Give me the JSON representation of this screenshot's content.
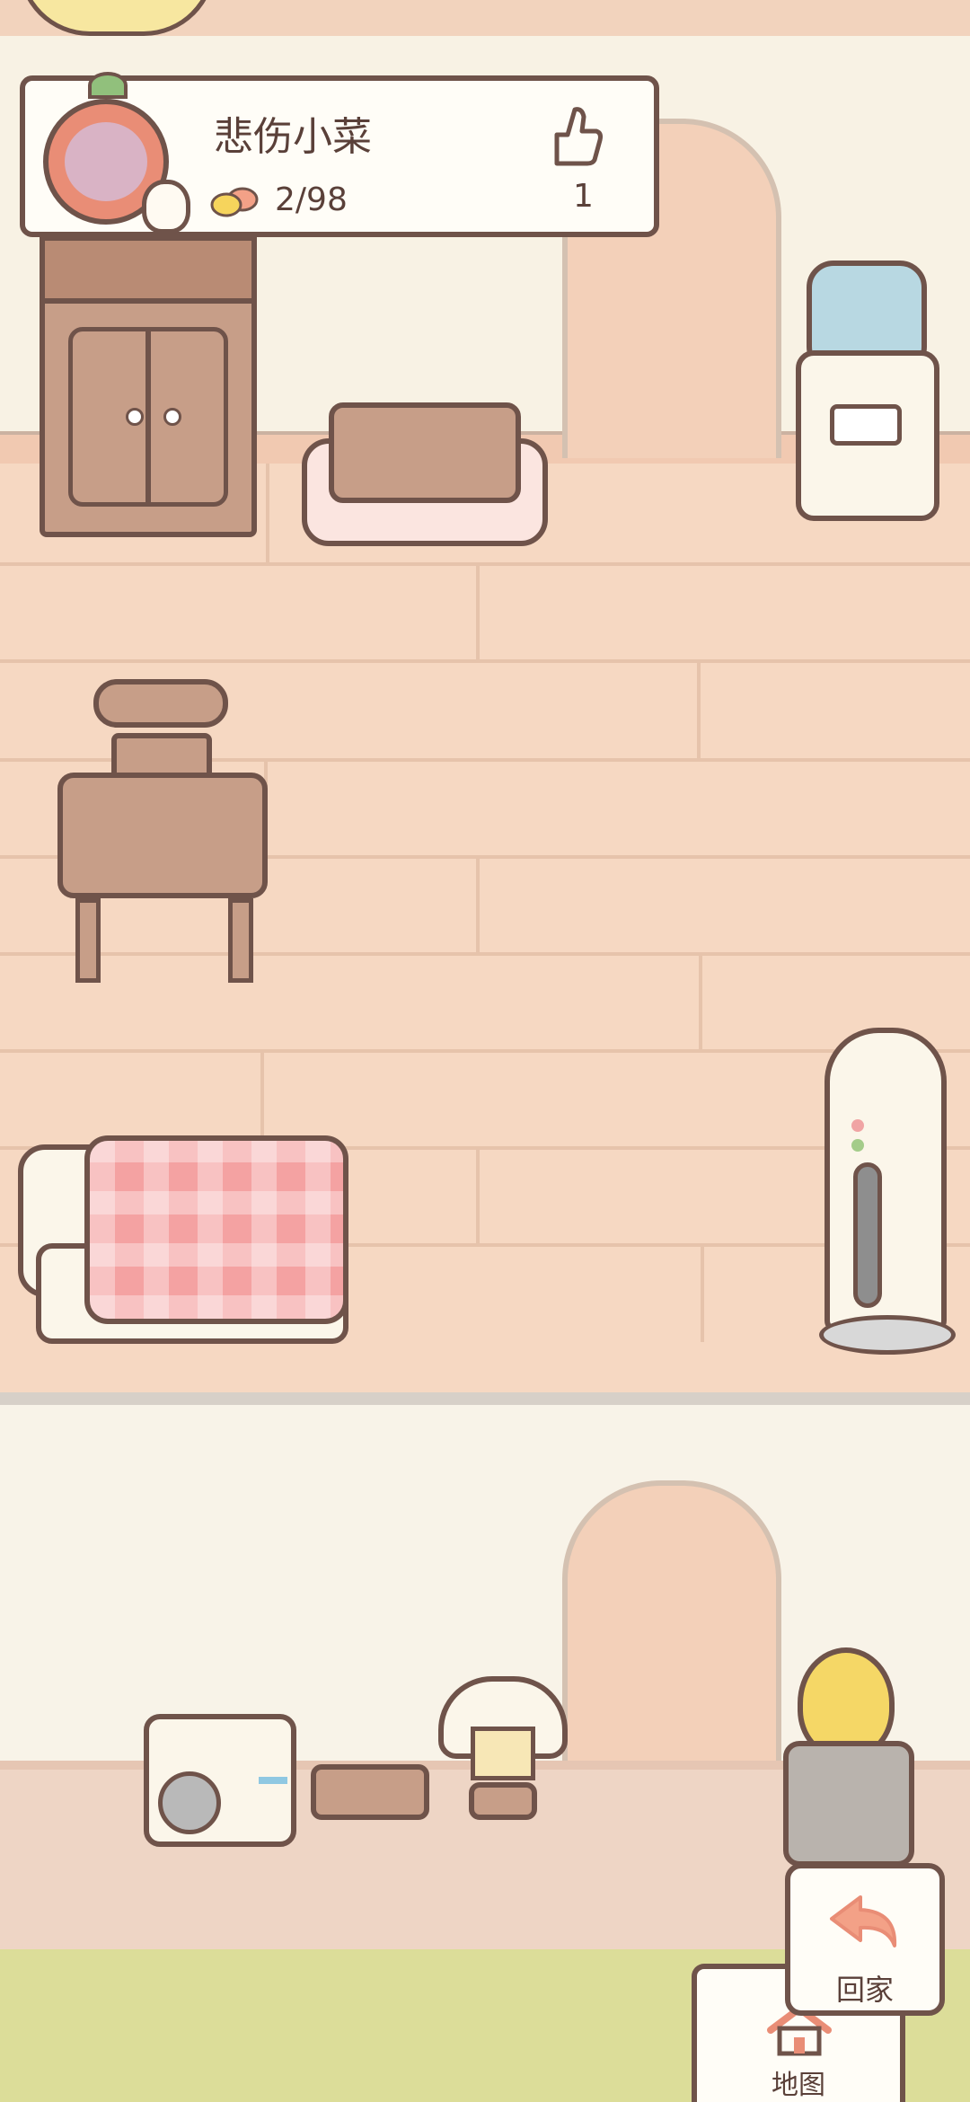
{
  "profile": {
    "username": "悲伤小菜",
    "coins": "2/98",
    "likes": "1",
    "avatar_icon": "radish-house-avatar",
    "coin_icon": "yellow-blob-icon",
    "like_icon": "thumbs-up-icon"
  },
  "buttons": {
    "home_label": "回家",
    "map_label": "地图"
  },
  "colors": {
    "outline": "#6f534a",
    "floor": "#f6d8c2",
    "wall": "#f8f2e4",
    "grass": "#dcdd99"
  }
}
